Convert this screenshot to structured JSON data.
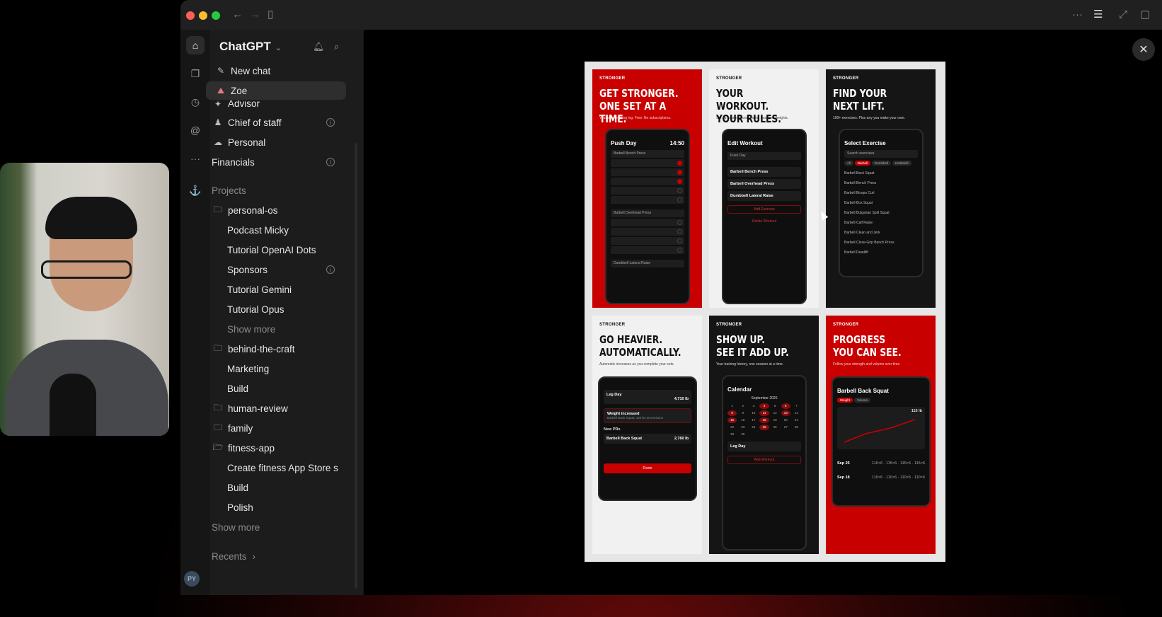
{
  "app": {
    "title": "ChatGPT",
    "user_initials": "PY"
  },
  "colors": {
    "accent_red": "#c80000",
    "sidebar_bg": "#1c1c1c",
    "selected_bg": "#2e2e2e"
  },
  "sidebar": {
    "new_chat": "New chat",
    "selected": "Zoe",
    "gpts": [
      "Advisor",
      "Chief of staff",
      "Personal",
      "Financials"
    ],
    "projects_label": "Projects",
    "projects": [
      {
        "name": "personal-os",
        "children": [
          "Podcast Micky",
          "Tutorial OpenAI Dots",
          "Sponsors",
          "Tutorial Gemini",
          "Tutorial Opus"
        ],
        "more": "Show more"
      },
      {
        "name": "behind-the-craft",
        "children": [
          "Marketing",
          "Build"
        ]
      },
      {
        "name": "human-review",
        "children": []
      },
      {
        "name": "family",
        "children": []
      },
      {
        "name": "fitness-app",
        "children": [
          "Create fitness App Store s",
          "Build",
          "Polish"
        ]
      }
    ],
    "show_more": "Show more",
    "recents": "Recents"
  },
  "viewer": {
    "brand": "STRONGER",
    "panels": [
      {
        "headline1": "GET STRONGER.",
        "headline2": "ONE SET AT A TIME.",
        "sub": "Your simple lifting log. Free. No subscriptions.",
        "screen_title": "Push Day",
        "screen_time": "14:50",
        "ex1": "Barbell Bench Press",
        "ex2": "Barbell Overhead Press",
        "ex3": "Dumbbell Lateral Raise"
      },
      {
        "headline1": "YOUR WORKOUT.",
        "headline2": "YOUR RULES.",
        "sub": "Set up your exercises, sets, reps and weights.",
        "screen_title": "Edit Workout",
        "field": "Push Day",
        "e1": "Barbell Bench Press",
        "e2": "Barbell Overhead Press",
        "e3": "Dumbbell Lateral Raise",
        "add": "Add Exercise",
        "delete": "Delete Workout"
      },
      {
        "headline1": "FIND YOUR",
        "headline2": "NEXT LIFT.",
        "sub": "100+ exercises. Plus any you make your own.",
        "screen_title": "Select Exercise",
        "search": "Search exercises",
        "list": [
          "Barbell Back Squat",
          "Barbell Bench Press",
          "Barbell Biceps Curl",
          "Barbell Box Squat",
          "Barbell Bulgarian Split Squat",
          "Barbell Calf Raise",
          "Barbell Clean and Jerk",
          "Barbell Close-Grip Bench Press",
          "Barbell Deadlift"
        ]
      },
      {
        "headline1": "GO HEAVIER.",
        "headline2": "AUTOMATICALLY.",
        "sub": "Automatic increases as you complete your sets.",
        "screen_title": "Leg Day",
        "volume": "4,710 lb",
        "notice": "Weight increased",
        "notice_sub": "Barbell Back Squat: 120 lb next session",
        "prs": "New PRs",
        "pr_row": "Barbell Back Squat",
        "pr_val": "2,760 lb",
        "done": "Done"
      },
      {
        "headline1": "SHOW UP.",
        "headline2": "SEE IT ADD UP.",
        "sub": "Your training history, one session at a time.",
        "screen_title": "Calendar",
        "month": "September 2026",
        "day_title": "Leg Day",
        "add_workout": "Add Workout"
      },
      {
        "headline1": "PROGRESS",
        "headline2": "YOU CAN SEE.",
        "sub": "Follow your strength and volume over time.",
        "screen_title": "Barbell Back Squat",
        "tab1": "Weight",
        "tab2": "Volume",
        "max": "115 lb",
        "h1_date": "Sep 25",
        "h1_sets": "110×6 · 115×6 · 115×6 · 115×6",
        "h2_date": "Sep 18",
        "h2_sets": "110×6 · 110×6 · 110×6 · 110×6"
      }
    ]
  }
}
